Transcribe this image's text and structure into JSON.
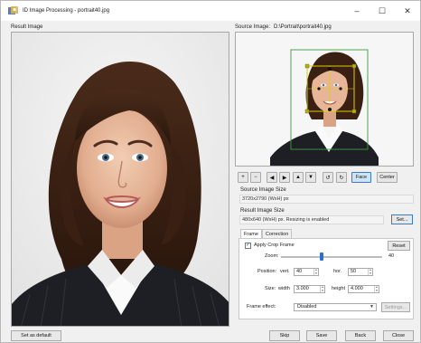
{
  "window": {
    "title": "ID Image Processing - portrait40.jpg",
    "controls": {
      "minimize": "–",
      "maximize": "☐",
      "close": "✕"
    }
  },
  "result_panel": {
    "label": "Result Image"
  },
  "source_panel": {
    "label": "Source Image:",
    "path": "D:\\Portrait\\portrait40.jpg"
  },
  "toolbar": {
    "buttons": [
      {
        "name": "zoom-in-button",
        "label": "+"
      },
      {
        "name": "zoom-out-button",
        "label": "−"
      },
      {
        "name": "move-left-button",
        "label": "◀"
      },
      {
        "name": "move-right-button",
        "label": "▶"
      },
      {
        "name": "move-up-button",
        "label": "▲"
      },
      {
        "name": "move-down-button",
        "label": "▼"
      },
      {
        "name": "rotate-left-button",
        "label": "↺"
      },
      {
        "name": "rotate-right-button",
        "label": "↻"
      }
    ],
    "face_label": "Face",
    "center_label": "Center"
  },
  "source_size": {
    "label": "Source Image Size",
    "value": "3720x2790 (WxH) px"
  },
  "result_size": {
    "label": "Result Image Size",
    "value": "480x640 (WxH) px. Resizing is enabled",
    "set_label": "Set..."
  },
  "tabs": {
    "frame": "Frame",
    "correction": "Correction"
  },
  "frame_tab": {
    "apply_crop_label": "Apply Crop Frame",
    "apply_crop_checked": true,
    "reset_label": "Reset",
    "zoom_label": "Zoom:",
    "zoom_value": "40",
    "zoom_fraction": 0.4,
    "position_label": "Position:",
    "vert_label": "vert.",
    "vert_value": "40",
    "hor_label": "hor.",
    "hor_value": "50",
    "size_label": "Size:",
    "width_label": "width",
    "width_value": "3.000",
    "height_label": "height",
    "height_value": "4.000",
    "frame_effect_label": "Frame effect:",
    "frame_effect_value": "Disabled",
    "settings_label": "Settings..."
  },
  "bottom": {
    "set_default_label": "Set as default",
    "skip_label": "Skip",
    "save_label": "Save",
    "back_label": "Back",
    "close_label": "Close"
  },
  "colors": {
    "accent": "#2a72c8",
    "crop_frame": "#3c9a3c",
    "handle": "#b7b100"
  }
}
